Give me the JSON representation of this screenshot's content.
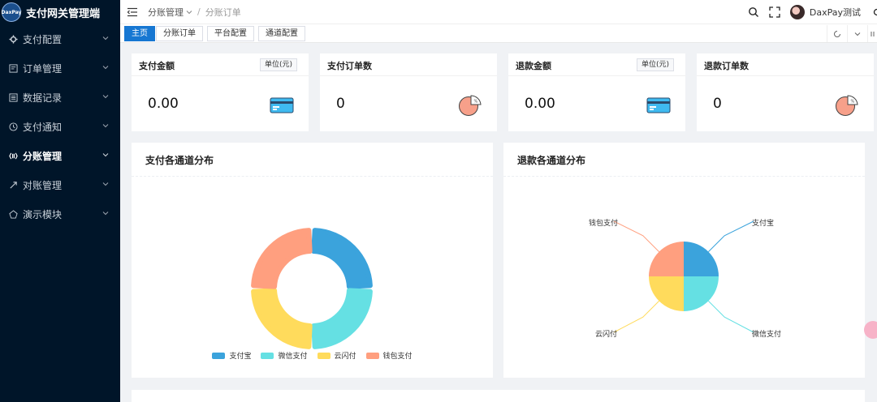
{
  "app": {
    "logo_text": "DaxPay",
    "title": "支付网关管理端"
  },
  "sidebar": {
    "items": [
      {
        "label": "支付配置",
        "icon": "gear-icon"
      },
      {
        "label": "订单管理",
        "icon": "order-icon"
      },
      {
        "label": "数据记录",
        "icon": "record-icon"
      },
      {
        "label": "支付通知",
        "icon": "notice-icon"
      },
      {
        "label": "分账管理",
        "icon": "split-icon",
        "active": true
      },
      {
        "label": "对账管理",
        "icon": "reconcile-icon"
      },
      {
        "label": "演示模块",
        "icon": "demo-icon"
      }
    ]
  },
  "header": {
    "breadcrumb": [
      "分账管理",
      "分账订单"
    ],
    "user_name": "DaxPay测试"
  },
  "tabs": [
    "主页",
    "分账订单",
    "平台配置",
    "通道配置"
  ],
  "stats": [
    {
      "title": "支付金额",
      "unit": "单位(元)",
      "value": "0.00",
      "icon": "card-icon"
    },
    {
      "title": "支付订单数",
      "value": "0",
      "icon": "pie-icon"
    },
    {
      "title": "退款金额",
      "unit": "单位(元)",
      "value": "0.00",
      "icon": "card-icon"
    },
    {
      "title": "退款订单数",
      "value": "0",
      "icon": "pie-icon"
    }
  ],
  "colors": {
    "alipay": "#3ba3dc",
    "wechat": "#65e0e3",
    "union": "#ffdb5c",
    "wallet": "#ff9f7f",
    "primary": "#1677d2"
  },
  "pay_chart": {
    "title": "支付各通道分布",
    "legend": [
      "支付宝",
      "微信支付",
      "云闪付",
      "钱包支付"
    ]
  },
  "refund_chart": {
    "title": "退款各通道分布",
    "labels": [
      "支付宝",
      "微信支付",
      "云闪付",
      "钱包支付"
    ]
  },
  "chart_data": [
    {
      "type": "pie",
      "title": "支付各通道分布",
      "categories": [
        "支付宝",
        "微信支付",
        "云闪付",
        "钱包支付"
      ],
      "values": [
        1,
        1,
        1,
        1
      ],
      "legend": "bottom"
    },
    {
      "type": "pie",
      "title": "退款各通道分布",
      "categories": [
        "支付宝",
        "微信支付",
        "云闪付",
        "钱包支付"
      ],
      "values": [
        1,
        1,
        1,
        1
      ]
    }
  ]
}
